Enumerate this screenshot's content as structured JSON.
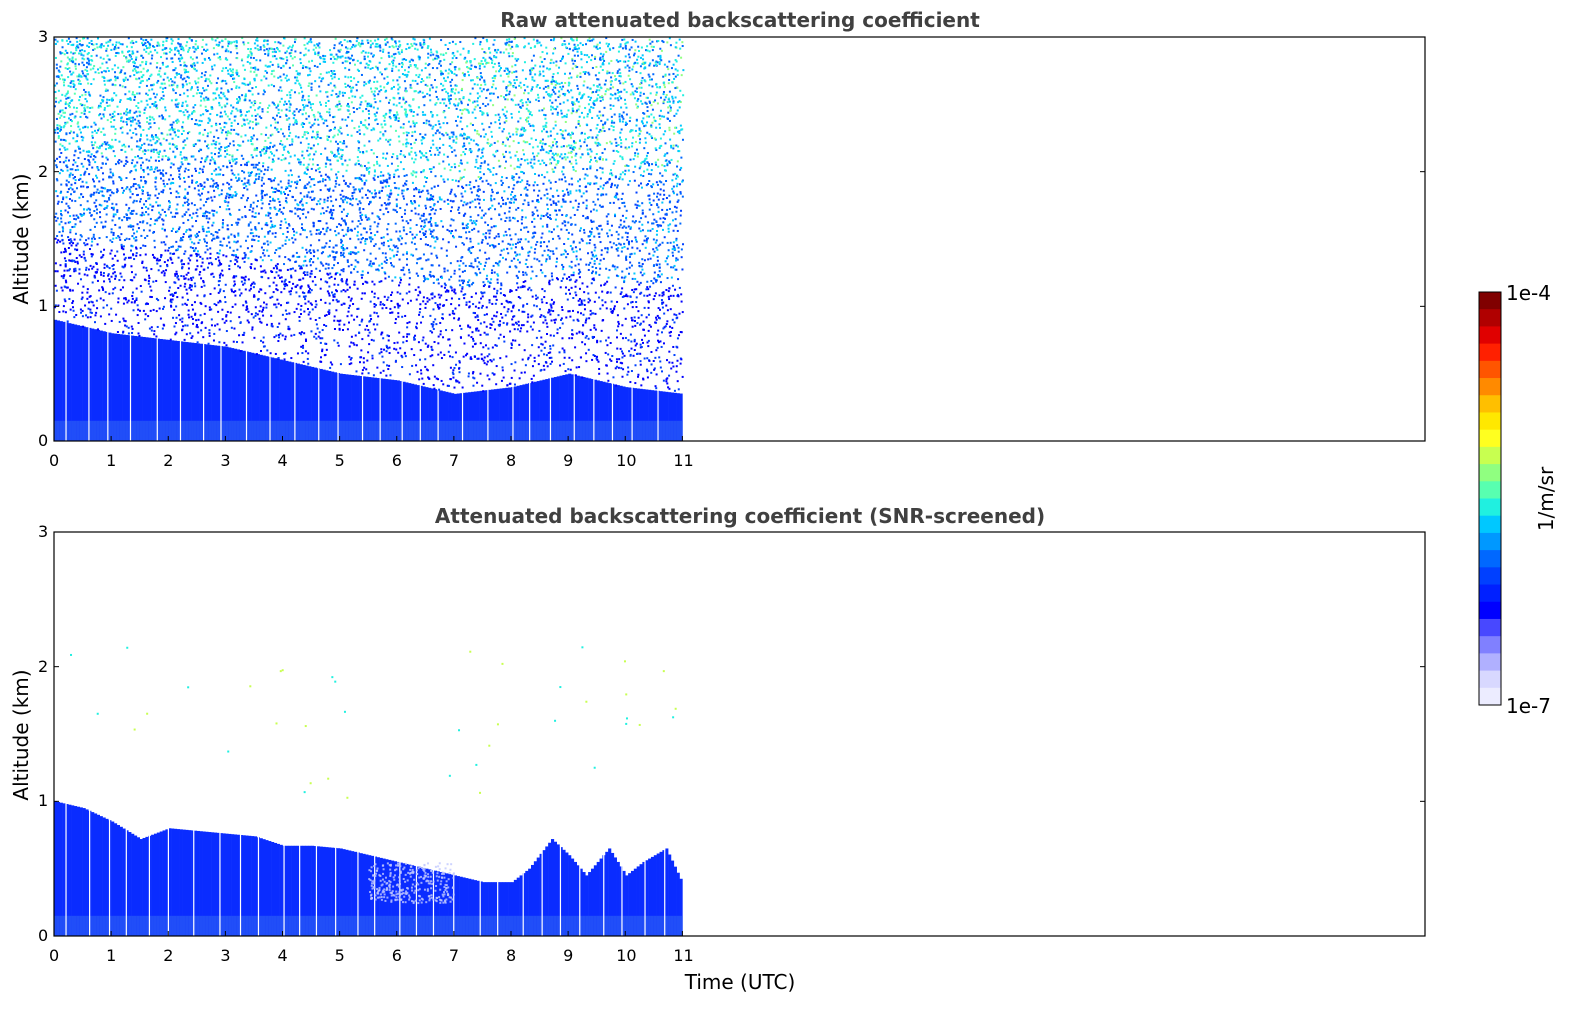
{
  "chart_data": [
    {
      "type": "heatmap",
      "title": "Raw attenuated backscattering coefficient",
      "xlabel": "",
      "ylabel": "Altitude (km)",
      "xlim": [
        0,
        24
      ],
      "ylim": [
        0,
        3
      ],
      "x_ticks": [
        "0",
        "1",
        "2",
        "3",
        "4",
        "5",
        "6",
        "7",
        "8",
        "9",
        "10",
        "11"
      ],
      "y_ticks": [
        "0",
        "1",
        "2",
        "3"
      ],
      "data_extent_hours": [
        0,
        11
      ],
      "profile": {
        "time": [
          0,
          1,
          2,
          3,
          4,
          5,
          6,
          7,
          8,
          9,
          10,
          11
        ],
        "dense_layer_top_km": [
          0.9,
          0.8,
          0.75,
          0.7,
          0.6,
          0.5,
          0.45,
          0.35,
          0.4,
          0.5,
          0.4,
          0.35
        ]
      },
      "noise": "sparse speckle up to 3 km"
    },
    {
      "type": "heatmap",
      "title": "Attenuated backscattering coefficient (SNR-screened)",
      "xlabel": "Time (UTC)",
      "ylabel": "Altitude (km)",
      "xlim": [
        0,
        24
      ],
      "ylim": [
        0,
        3
      ],
      "x_ticks": [
        "0",
        "1",
        "2",
        "3",
        "4",
        "5",
        "6",
        "7",
        "8",
        "9",
        "10",
        "11"
      ],
      "y_ticks": [
        "0",
        "1",
        "2",
        "3"
      ],
      "data_extent_hours": [
        0,
        11
      ],
      "profile": {
        "time": [
          0,
          0.5,
          1,
          1.5,
          2,
          2.5,
          3,
          3.5,
          4,
          4.5,
          5,
          5.5,
          6,
          6.5,
          7,
          7.5,
          8,
          8.3,
          8.7,
          9,
          9.3,
          9.7,
          10,
          10.3,
          10.7,
          11
        ],
        "layer_top_km": [
          1.0,
          0.95,
          0.85,
          0.72,
          0.8,
          0.78,
          0.76,
          0.74,
          0.67,
          0.67,
          0.65,
          0.6,
          0.55,
          0.5,
          0.45,
          0.4,
          0.4,
          0.5,
          0.72,
          0.6,
          0.45,
          0.65,
          0.45,
          0.55,
          0.65,
          0.38
        ]
      }
    }
  ],
  "colorbar": {
    "max_label": "1e-4",
    "min_label": "1e-7",
    "unit_label": "1/m/sr",
    "colors": [
      "#800000",
      "#b00000",
      "#e00000",
      "#ff2000",
      "#ff5500",
      "#ff8a00",
      "#ffbf00",
      "#ffe800",
      "#ffff20",
      "#c8ff50",
      "#90ff80",
      "#58ffb0",
      "#20f0e0",
      "#00c8ff",
      "#0098ff",
      "#0068ff",
      "#0040ff",
      "#0020ff",
      "#0000ff",
      "#4848ff",
      "#8080ff",
      "#b0b0ff",
      "#d8d8ff",
      "#ececff"
    ]
  }
}
